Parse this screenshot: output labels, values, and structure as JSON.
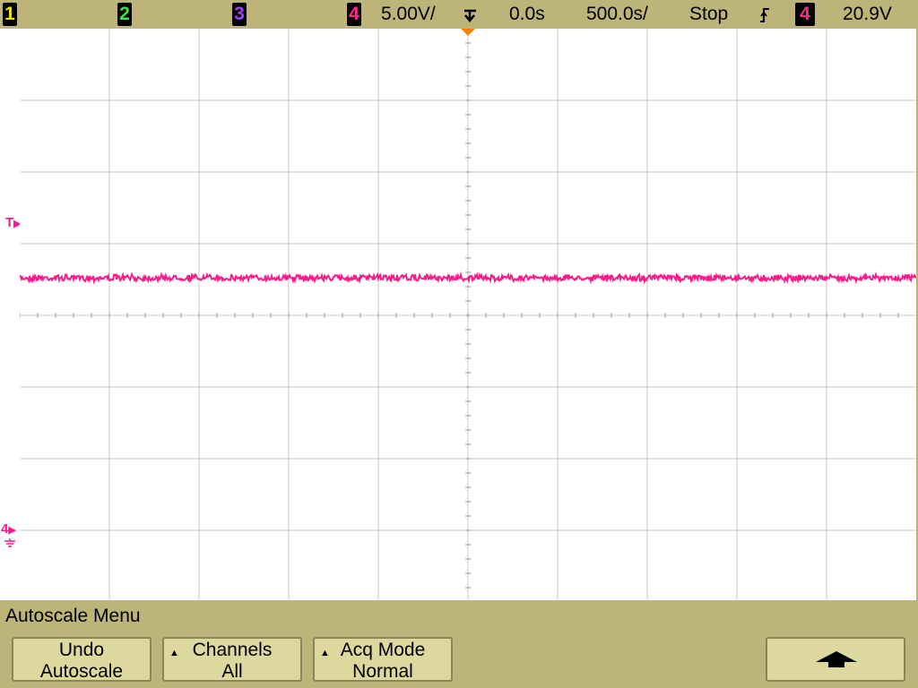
{
  "status_bar": {
    "ch1_label": "1",
    "ch2_label": "2",
    "ch3_label": "3",
    "ch4_label": "4",
    "ch4_scale": "5.00V/",
    "time_delay": "0.0s",
    "time_scale": "500.0s/",
    "run_state": "Stop",
    "trigger_slope_icon": "rising-edge-icon",
    "trigger_source": "4",
    "trigger_level": "20.9V"
  },
  "markers": {
    "trigger_level_marker": "T",
    "ch4_ground_marker": "4"
  },
  "waveform": {
    "channel": "4",
    "color": "#ff1a8c",
    "level_fraction_of_screen_height": 0.436
  },
  "menu": {
    "title": "Autoscale Menu",
    "buttons": [
      {
        "line1": "Undo",
        "line2": "Autoscale"
      },
      {
        "line1": "Channels",
        "line2": "All"
      },
      {
        "line1": "Acq Mode",
        "line2": "Normal"
      }
    ],
    "up_button_icon": "up-arrow-icon"
  },
  "colors": {
    "bezel": "#bdb47a",
    "grid": "#c8c8c8",
    "ch4": "#ff1a8c",
    "trigger_marker": "#ff8000"
  }
}
